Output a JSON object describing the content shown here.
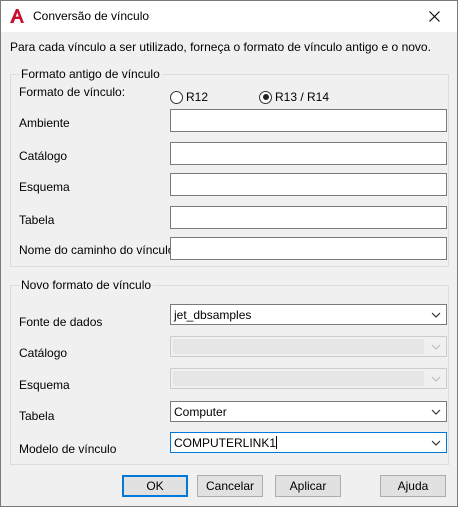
{
  "window": {
    "title": "Conversão de vínculo",
    "instructions": "Para cada vínculo a ser utilizado, forneça o formato de vínculo antigo e o novo."
  },
  "old_format": {
    "legend": "Formato antigo de vínculo",
    "link_format_label": "Formato de vínculo:",
    "radio_r12": "R12",
    "radio_r13": "R13 / R14",
    "selected": "R13 / R14",
    "environment_label": "Ambiente",
    "environment_value": "",
    "catalog_label": "Catálogo",
    "catalog_value": "",
    "schema_label": "Esquema",
    "schema_value": "",
    "table_label": "Tabela",
    "table_value": "",
    "path_label": "Nome do caminho do vínculo",
    "path_value": ""
  },
  "new_format": {
    "legend": "Novo formato de vínculo",
    "datasource_label": "Fonte de dados",
    "datasource_value": "jet_dbsamples",
    "catalog_label": "Catálogo",
    "catalog_value": "",
    "schema_label": "Esquema",
    "schema_value": "",
    "table_label": "Tabela",
    "table_value": "Computer",
    "template_label": "Modelo de vínculo",
    "template_value": "COMPUTERLINK1"
  },
  "buttons": {
    "ok": "OK",
    "cancel": "Cancelar",
    "apply": "Aplicar",
    "help": "Ajuda"
  },
  "colors": {
    "accent": "#0078d7",
    "app_icon": "#c8102e",
    "dialog_bg": "#f0f0f0"
  },
  "icons": {
    "app": "autocad-a-icon",
    "close": "close-icon",
    "dropdown": "chevron-down-icon"
  }
}
